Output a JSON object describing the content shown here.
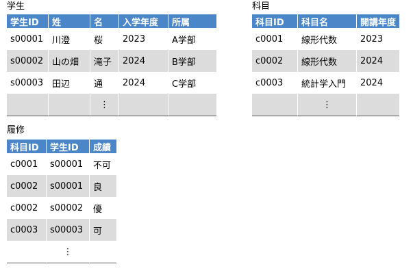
{
  "students": {
    "caption": "学生",
    "headers": [
      "学生ID",
      "姓",
      "名",
      "入学年度",
      "所属"
    ],
    "rows": [
      [
        "s00001",
        "川澄",
        "桜",
        "2023",
        "A学部"
      ],
      [
        "s00002",
        "山の畑",
        "滝子",
        "2024",
        "B学部"
      ],
      [
        "s00003",
        "田辺",
        "通",
        "2024",
        "C学部"
      ]
    ],
    "ellipsis": "⋮"
  },
  "subjects": {
    "caption": "科目",
    "headers": [
      "科目ID",
      "科目名",
      "開講年度"
    ],
    "rows": [
      [
        "c0001",
        "線形代数",
        "2023"
      ],
      [
        "c0002",
        "線形代数",
        "2024"
      ],
      [
        "c0003",
        "統計学入門",
        "2024"
      ]
    ],
    "ellipsis": "⋮"
  },
  "enrollments": {
    "caption": "履修",
    "headers": [
      "科目ID",
      "学生ID",
      "成績"
    ],
    "rows": [
      [
        "c0001",
        "s00001",
        "不可"
      ],
      [
        "c0002",
        "s00001",
        "良"
      ],
      [
        "c0002",
        "s00002",
        "優"
      ],
      [
        "c0003",
        "s00003",
        "可"
      ]
    ],
    "ellipsis": "⋮"
  }
}
